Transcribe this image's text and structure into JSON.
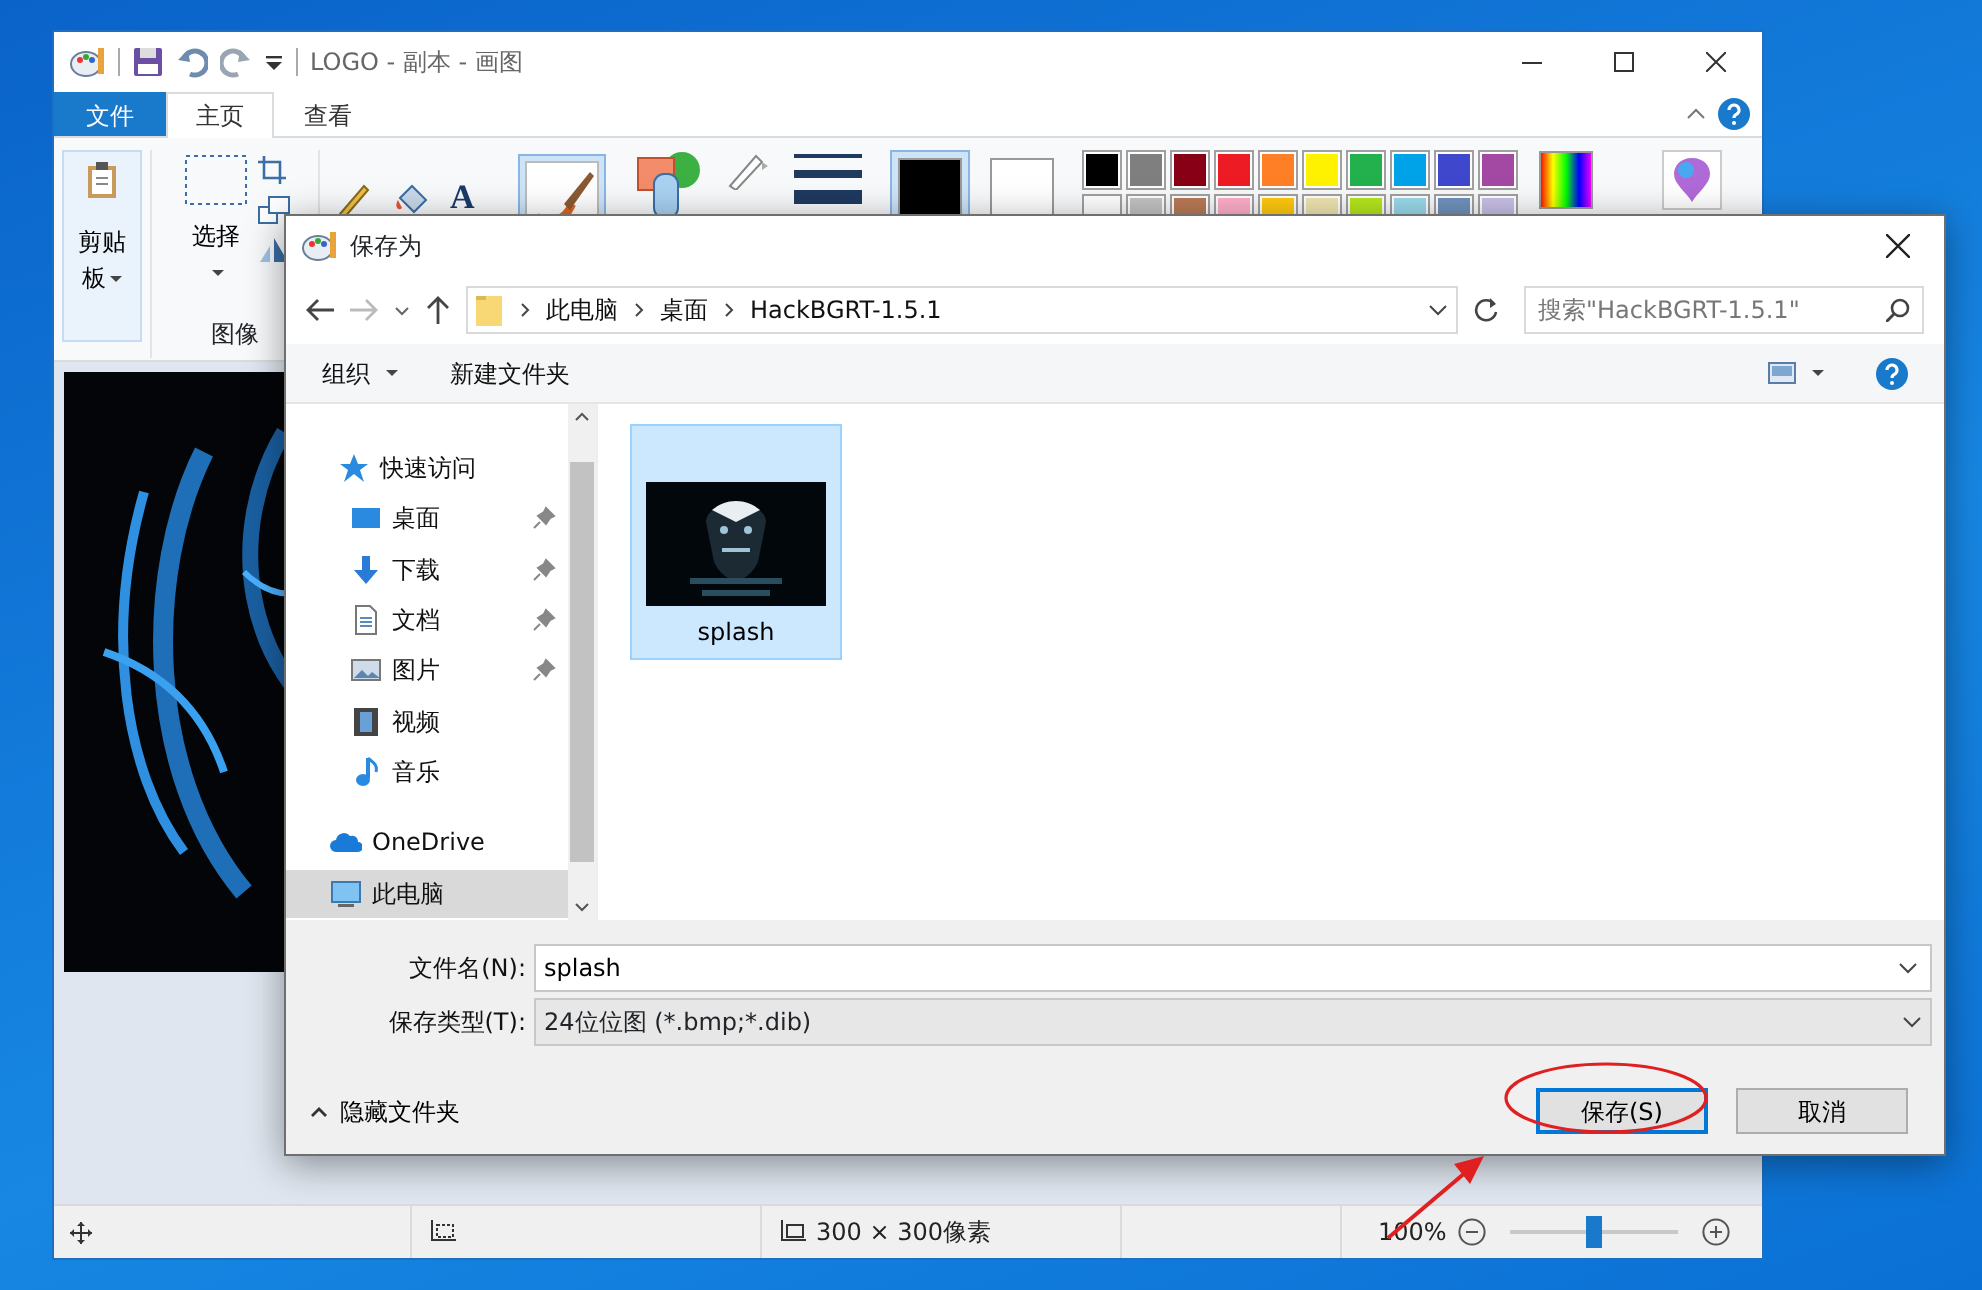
{
  "paint_window": {
    "title": "LOGO - 副本 - 画图",
    "tabs": [
      {
        "label": "文件",
        "kind": "file",
        "selected": false
      },
      {
        "label": "主页",
        "kind": "tab",
        "selected": true
      },
      {
        "label": "查看",
        "kind": "tab",
        "selected": false
      }
    ],
    "ribbon": {
      "clipboard": {
        "label": "剪贴板"
      },
      "select": {
        "label": "选择"
      },
      "image_group": {
        "label": "图像"
      },
      "tools": [
        {
          "kind": "pencil",
          "selected": false
        },
        {
          "kind": "fill",
          "selected": false
        },
        {
          "kind": "text",
          "label": "A",
          "selected": false
        },
        {
          "kind": "brush",
          "selected": true
        }
      ],
      "color_slots": [
        {
          "color": "#000000",
          "selected": true
        },
        {
          "color": "#ffffff",
          "selected": false
        }
      ],
      "palette": [
        {
          "color": "#000000"
        },
        {
          "color": "#7f7f7f"
        },
        {
          "color": "#880015"
        },
        {
          "color": "#ed1c24"
        },
        {
          "color": "#ff7f27"
        },
        {
          "color": "#fff200"
        },
        {
          "color": "#22b14c"
        },
        {
          "color": "#00a2e8"
        },
        {
          "color": "#3f48cc"
        },
        {
          "color": "#a349a4"
        },
        {
          "color": "#ffffff"
        },
        {
          "color": "#c3c3c3"
        },
        {
          "color": "#b97a57"
        },
        {
          "color": "#ffaec9"
        },
        {
          "color": "#ffc90e"
        },
        {
          "color": "#efe4b0"
        },
        {
          "color": "#b5e61d"
        },
        {
          "color": "#99d9ea"
        },
        {
          "color": "#7092be"
        },
        {
          "color": "#c8bfe7"
        }
      ]
    },
    "status_bar": {
      "size": "300 × 300像素",
      "zoom": "100%",
      "zoom_slider": {
        "level": 0.5
      }
    }
  },
  "dialog": {
    "title": "保存为",
    "path": [
      "此电脑",
      "桌面",
      "HackBGRT-1.5.1"
    ],
    "search": {
      "placeholder": "搜索\"HackBGRT-1.5.1\""
    },
    "toolbar": [
      {
        "label": "组织",
        "dropdown": true
      },
      {
        "label": "新建文件夹",
        "dropdown": false
      }
    ],
    "nav": [
      {
        "label": "快速访问",
        "kind": "star",
        "selected": false,
        "children": [
          {
            "label": "桌面",
            "kind": "desktop",
            "pinned": true,
            "selected": false
          },
          {
            "label": "下载",
            "kind": "download",
            "pinned": true,
            "selected": false
          },
          {
            "label": "文档",
            "kind": "document",
            "pinned": true,
            "selected": false
          },
          {
            "label": "图片",
            "kind": "pictures",
            "pinned": true,
            "selected": false
          },
          {
            "label": "视频",
            "kind": "video",
            "pinned": false,
            "selected": false
          },
          {
            "label": "音乐",
            "kind": "music",
            "pinned": false,
            "selected": false
          }
        ]
      },
      {
        "label": "OneDrive",
        "kind": "cloud",
        "selected": false
      },
      {
        "label": "此电脑",
        "kind": "pc",
        "selected": true
      }
    ],
    "files": [
      {
        "name": "splash",
        "kind": "picture",
        "selected": true
      }
    ],
    "filename": {
      "label": "文件名(N):",
      "value": "splash"
    },
    "filetype": {
      "label": "保存类型(T):",
      "value": "24位位图 (*.bmp;*.dib)"
    },
    "hide_folders": "隐藏文件夹",
    "buttons": [
      {
        "label": "保存(S)",
        "default": true
      },
      {
        "label": "取消",
        "default": false
      }
    ]
  },
  "annotations": [
    {
      "kind": "ellipse"
    },
    {
      "kind": "arrow"
    }
  ]
}
